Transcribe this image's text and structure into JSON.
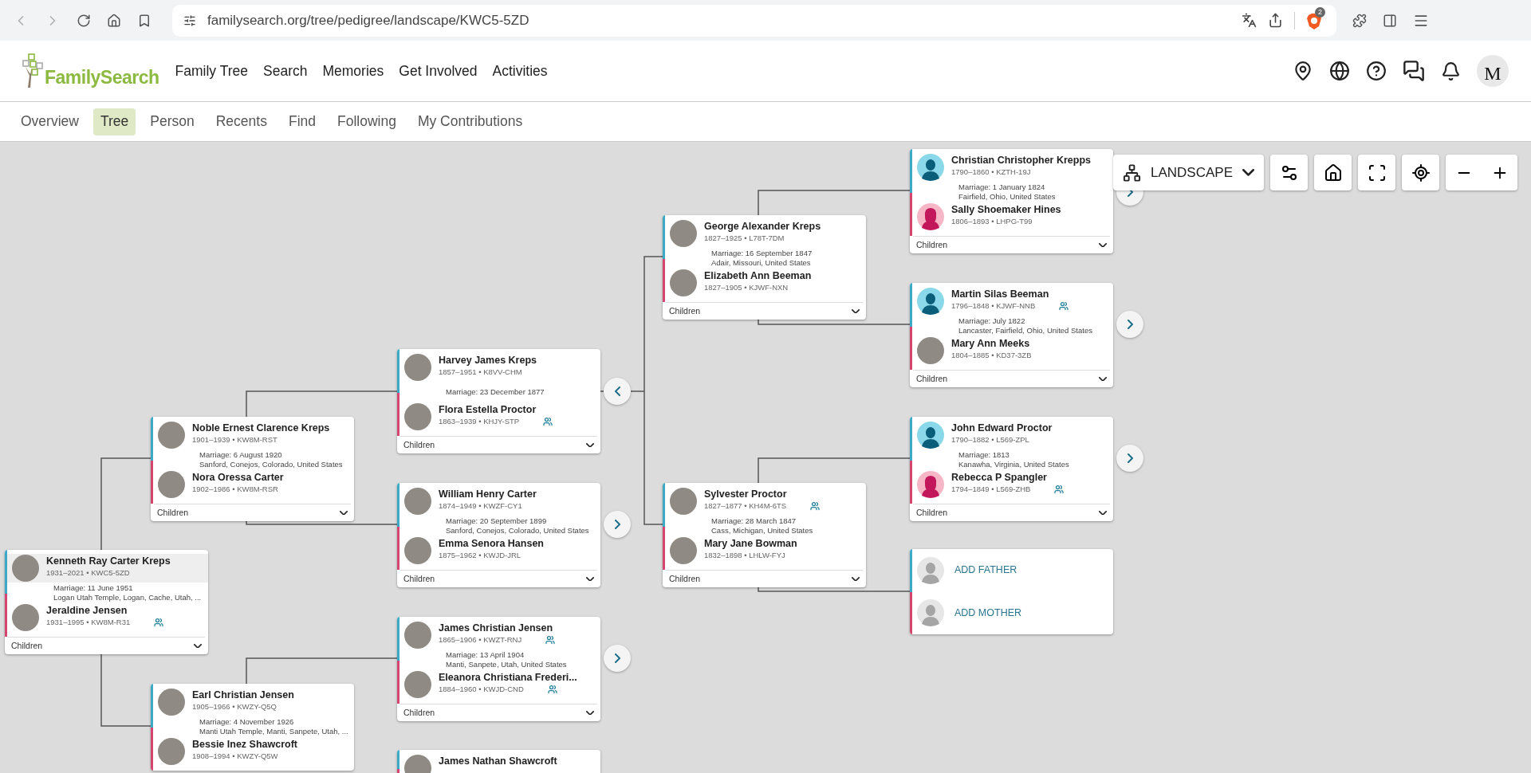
{
  "browser": {
    "url": "familysearch.org/tree/pedigree/landscape/KWC5-5ZD",
    "shield_badge": "2"
  },
  "header": {
    "logo": "FamilySearch",
    "nav": [
      "Family Tree",
      "Search",
      "Memories",
      "Get Involved",
      "Activities"
    ],
    "avatar_letter": "M"
  },
  "subnav": [
    {
      "label": "Overview",
      "selected": false
    },
    {
      "label": "Tree",
      "selected": true
    },
    {
      "label": "Person",
      "selected": false
    },
    {
      "label": "Recents",
      "selected": false
    },
    {
      "label": "Find",
      "selected": false
    },
    {
      "label": "Following",
      "selected": false
    },
    {
      "label": "My Contributions",
      "selected": false
    }
  ],
  "toolbar": {
    "view": "LANDSCAPE"
  },
  "couples": [
    {
      "kind": "couple",
      "selected": true,
      "husband": {
        "name": "Kenneth Ray Carter Kreps",
        "info": "1931–2021 • KWC5-5ZD",
        "kind": "photo",
        "linked": false
      },
      "marriage": "Marriage: 11 June 1951",
      "place": "Logan Utah Temple, Logan, Cache, Utah, ...",
      "wife": {
        "name": "Jeraldine Jensen",
        "info": "1931–1995 • KW8M-R31",
        "kind": "photo",
        "linked": true
      },
      "children": "Children"
    },
    {
      "kind": "couple",
      "selected": false,
      "husband": {
        "name": "Noble Ernest Clarence Kreps",
        "info": "1901–1939 • KW8M-RST",
        "kind": "photo",
        "linked": false
      },
      "marriage": "Marriage: 6 August 1920",
      "place": "Sanford, Conejos, Colorado, United States",
      "wife": {
        "name": "Nora Oressa Carter",
        "info": "1902–1986 • KW8M-RSR",
        "kind": "photo",
        "linked": false
      },
      "children": "Children"
    },
    {
      "kind": "couple",
      "selected": false,
      "husband": {
        "name": "Earl Christian Jensen",
        "info": "1905–1966 • KWZY-Q5Q",
        "kind": "photo",
        "linked": false
      },
      "marriage": "Marriage: 4 November 1926",
      "place": "Manti Utah Temple, Manti, Sanpete, Utah, ...",
      "wife": {
        "name": "Bessie Inez Shawcroft",
        "info": "1908–1994 • KWZY-Q5W",
        "kind": "photo",
        "linked": false
      }
    },
    {
      "kind": "couple",
      "selected": false,
      "husband": {
        "name": "Harvey James Kreps",
        "info": "1857–1951 • K8VV-CHM",
        "kind": "photo",
        "linked": false
      },
      "marriage": "Marriage: 23 December 1877",
      "wife": {
        "name": "Flora Estella Proctor",
        "info": "1863–1939 • KHJY-STP",
        "kind": "photo",
        "linked": true
      },
      "children": "Children"
    },
    {
      "kind": "couple",
      "selected": false,
      "husband": {
        "name": "William Henry Carter",
        "info": "1874–1949 • KWZF-CY1",
        "kind": "photo",
        "linked": false
      },
      "marriage": "Marriage: 20 September 1899",
      "place": "Sanford, Conejos, Colorado, United States",
      "wife": {
        "name": "Emma Senora Hansen",
        "info": "1875–1962 • KWJD-JRL",
        "kind": "photo",
        "linked": false
      },
      "children": "Children"
    },
    {
      "kind": "couple",
      "selected": false,
      "husband": {
        "name": "James Christian Jensen",
        "info": "1865–1906 • KWZT-RNJ",
        "kind": "photo",
        "linked": true
      },
      "marriage": "Marriage: 13 April 1904",
      "place": "Manti, Sanpete, Utah, United States",
      "wife": {
        "name": "Eleanora Christiana Frederi...",
        "info": "1884–1960 • KWJD-CND",
        "kind": "photo",
        "linked": true
      },
      "children": "Children"
    },
    {
      "kind": "couple",
      "selected": false,
      "husband": {
        "name": "James Nathan Shawcroft",
        "kind": "photo"
      }
    },
    {
      "kind": "couple",
      "selected": false,
      "husband": {
        "name": "George Alexander Kreps",
        "info": "1827–1925 • L78T-7DM",
        "kind": "photo",
        "linked": false
      },
      "marriage": "Marriage: 16 September 1847",
      "place": "Adair, Missouri, United States",
      "wife": {
        "name": "Elizabeth Ann Beeman",
        "info": "1827–1905 • KJWF-NXN",
        "kind": "photo",
        "linked": false
      },
      "children": "Children"
    },
    {
      "kind": "couple",
      "selected": false,
      "husband": {
        "name": "Sylvester Proctor",
        "info": "1827–1877 • KH4M-6TS",
        "kind": "photo",
        "linked": true
      },
      "marriage": "Marriage: 28 March 1847",
      "place": "Cass, Michigan, United States",
      "wife": {
        "name": "Mary Jane Bowman",
        "info": "1832–1898 • LHLW-FYJ",
        "kind": "photo",
        "linked": false
      },
      "children": "Children"
    },
    {
      "kind": "couple",
      "selected": false,
      "husband": {
        "name": "Christian Christopher Krepps",
        "info": "1790–1860 • KZTH-19J",
        "kind": "male",
        "linked": false
      },
      "marriage": "Marriage: 1 January 1824",
      "place": "Fairfield, Ohio, United States",
      "wife": {
        "name": "Sally Shoemaker Hines",
        "info": "1806–1893 • LHPG-T99",
        "kind": "female",
        "linked": false
      },
      "children": "Children"
    },
    {
      "kind": "couple",
      "selected": false,
      "husband": {
        "name": "Martin Silas Beeman",
        "info": "1796–1848 • KJWF-NNB",
        "kind": "male",
        "linked": true
      },
      "marriage": "Marriage: July 1822",
      "place": "Lancaster, Fairfield, Ohio, United States",
      "wife": {
        "name": "Mary Ann Meeks",
        "info": "1804–1885 • KD37-3ZB",
        "kind": "photo",
        "linked": false
      },
      "children": "Children"
    },
    {
      "kind": "couple",
      "selected": false,
      "husband": {
        "name": "John Edward Proctor",
        "info": "1790–1882 • L569-ZPL",
        "kind": "male",
        "linked": false
      },
      "marriage": "Marriage: 1813",
      "place": "Kanawha, Virginia, United States",
      "wife": {
        "name": "Rebecca P Spangler",
        "info": "1794–1849 • L569-ZHB",
        "kind": "female",
        "linked": true
      },
      "children": "Children"
    },
    {
      "kind": "add",
      "father": "ADD FATHER",
      "mother": "ADD MOTHER"
    }
  ]
}
